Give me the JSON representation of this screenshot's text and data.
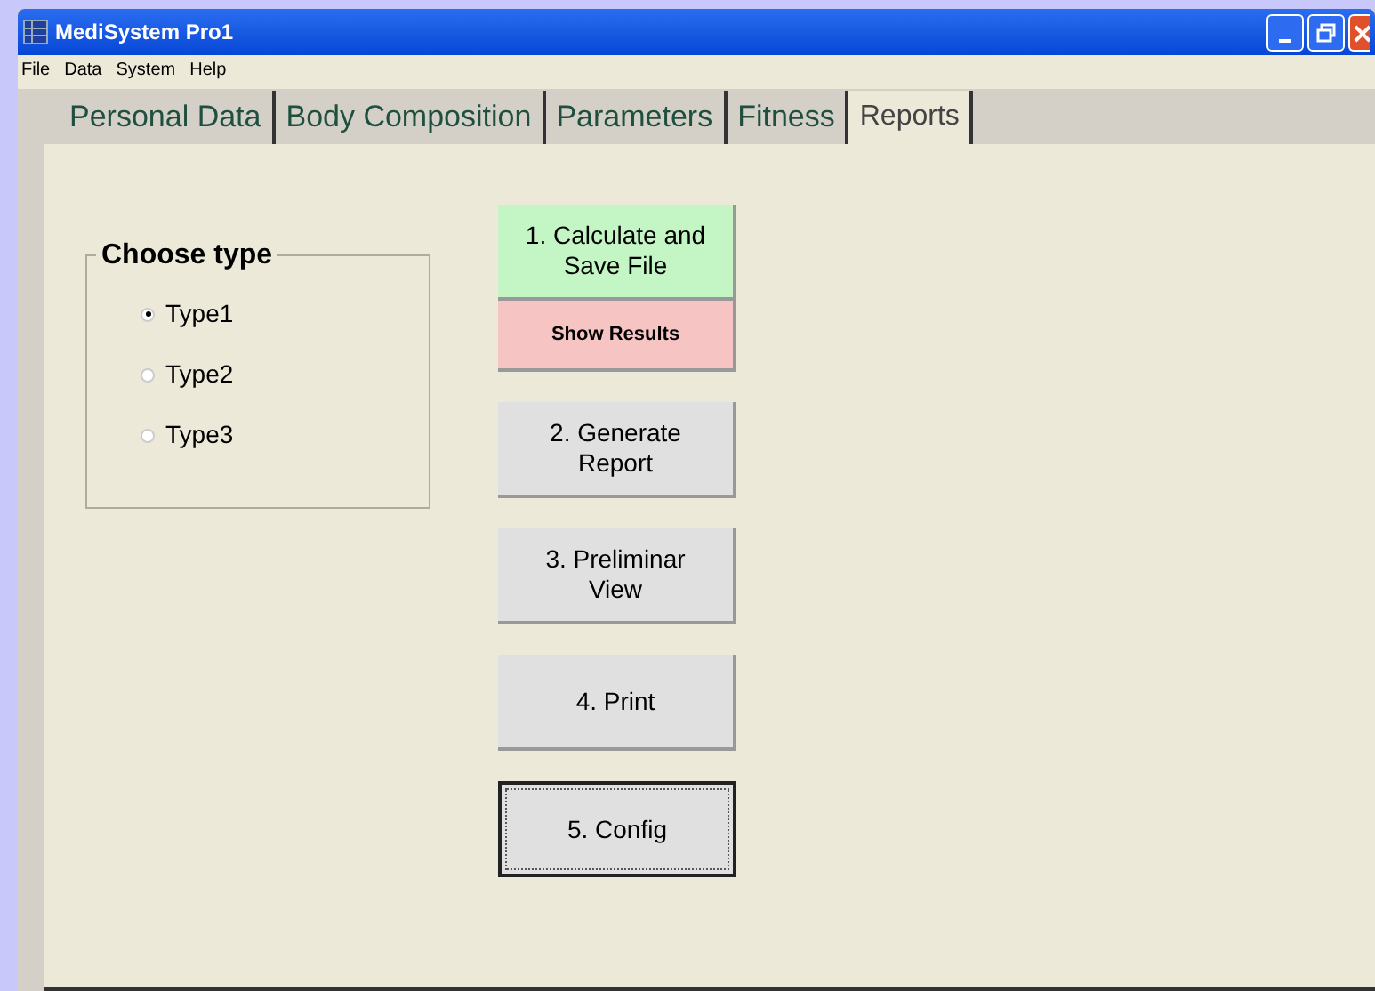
{
  "window": {
    "title": "MediSystem Pro1"
  },
  "menu": [
    "File",
    "Data",
    "System",
    "Help"
  ],
  "tabs": [
    {
      "label": "Personal Data",
      "selected": false
    },
    {
      "label": "Body Composition",
      "selected": false
    },
    {
      "label": "Parameters",
      "selected": false
    },
    {
      "label": "Fitness",
      "selected": false
    },
    {
      "label": "Reports",
      "selected": true
    }
  ],
  "choose_type": {
    "title": "Choose type",
    "options": [
      {
        "label": "Type1",
        "selected": true
      },
      {
        "label": "Type2",
        "selected": false
      },
      {
        "label": "Type3",
        "selected": false
      }
    ]
  },
  "buttons": [
    {
      "label": "1. Calculate and Save File",
      "color": "#c4f5c4",
      "focused": false,
      "attached": {
        "label": "Show Results",
        "color": "#f7c4c4"
      }
    },
    {
      "label": "2. Generate Report",
      "color": "#e0e0e0",
      "focused": false
    },
    {
      "label": "3. Preliminar View",
      "color": "#e0e0e0",
      "focused": false
    },
    {
      "label": "4. Print",
      "color": "#e0e0e0",
      "focused": false
    },
    {
      "label": "5. Config",
      "color": "#e0e0e0",
      "focused": true
    }
  ]
}
